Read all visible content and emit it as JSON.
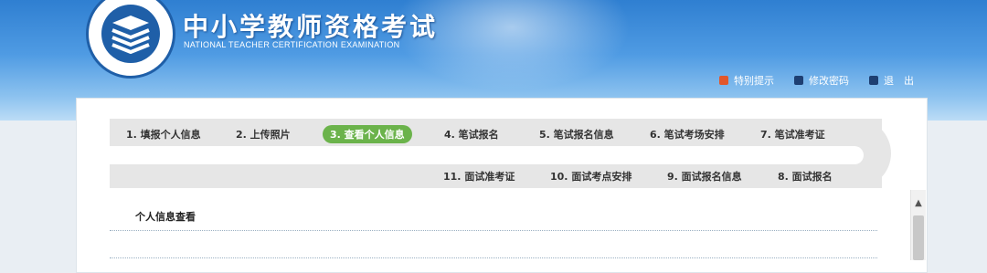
{
  "header": {
    "title": "中小学教师资格考试",
    "subtitle": "NATIONAL TEACHER CERTIFICATION EXAMINATION",
    "emblem_ring_text": "National Teacher Certification Examination",
    "links": [
      {
        "label": "特别提示",
        "icon": "notice-icon"
      },
      {
        "label": "修改密码",
        "icon": "password-icon"
      },
      {
        "label": "退　出",
        "icon": "exit-icon"
      }
    ]
  },
  "steps_row1": [
    {
      "label": "1. 填报个人信息"
    },
    {
      "label": "2. 上传照片"
    },
    {
      "label": "3. 查看个人信息",
      "active": true
    },
    {
      "label": "4. 笔试报名"
    },
    {
      "label": "5. 笔试报名信息"
    },
    {
      "label": "6. 笔试考场安排"
    },
    {
      "label": "7. 笔试准考证"
    }
  ],
  "steps_row2": [
    {
      "label": "11. 面试准考证"
    },
    {
      "label": "10. 面试考点安排"
    },
    {
      "label": "9. 面试报名信息"
    },
    {
      "label": "8. 面试报名"
    }
  ],
  "section": {
    "title": "个人信息查看"
  },
  "colors": {
    "header_blue": "#2f7fd1",
    "active_step": "#6bb34b",
    "track_gray": "#e6e6e6"
  }
}
